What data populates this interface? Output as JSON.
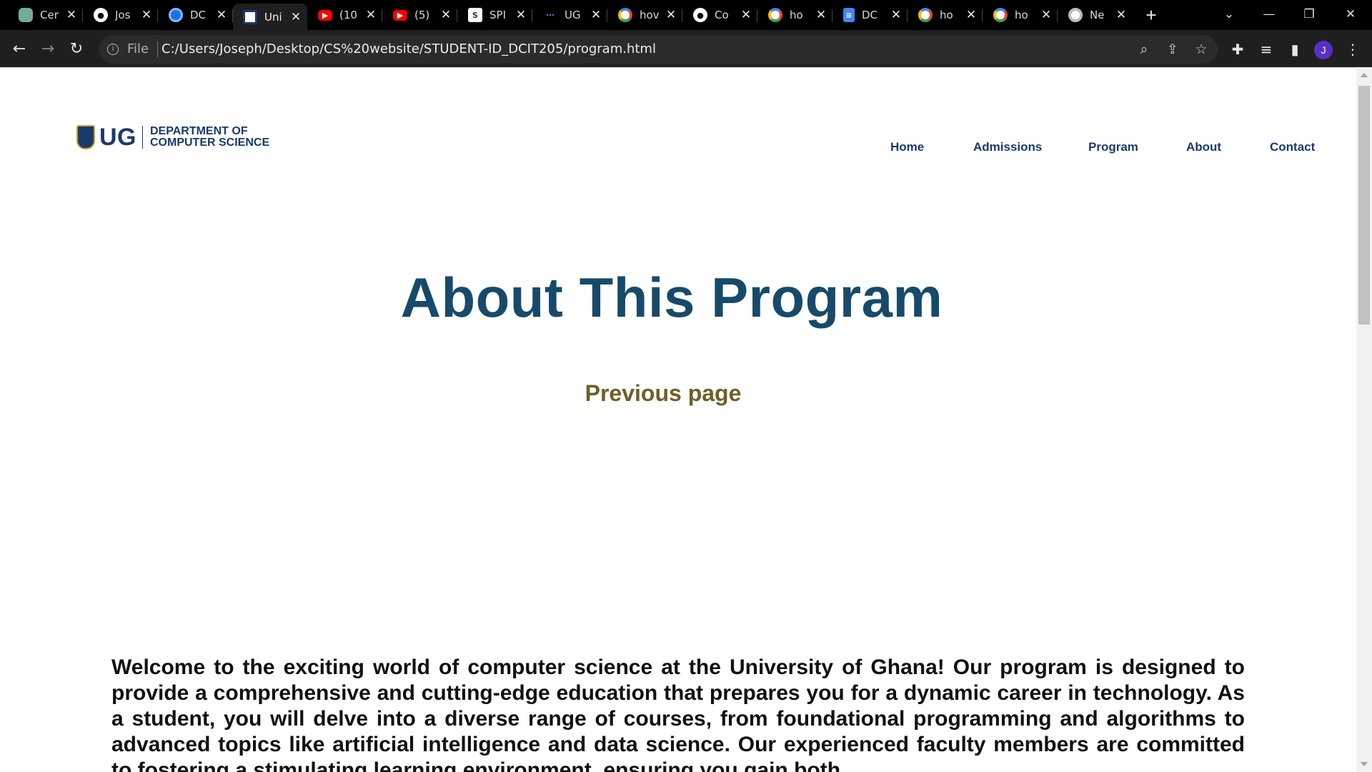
{
  "browser": {
    "tabs": [
      {
        "title": "Cer",
        "favicon": "chatgpt-icon",
        "active": false
      },
      {
        "title": "Jos",
        "favicon": "github-icon",
        "active": false
      },
      {
        "title": "DC",
        "favicon": "dc-icon",
        "active": false
      },
      {
        "title": "Uni",
        "favicon": "ug-crest-icon",
        "active": true
      },
      {
        "title": "(10",
        "favicon": "youtube-icon",
        "active": false
      },
      {
        "title": "(5)",
        "favicon": "youtube-icon",
        "active": false
      },
      {
        "title": "SPI",
        "favicon": "spl-icon",
        "active": false
      },
      {
        "title": "UG",
        "favicon": "ug-dots-icon",
        "active": false
      },
      {
        "title": "hov",
        "favicon": "google-icon",
        "active": false
      },
      {
        "title": "Co",
        "favicon": "github-icon",
        "active": false
      },
      {
        "title": "ho",
        "favicon": "google-icon",
        "active": false
      },
      {
        "title": "DC",
        "favicon": "google-docs-icon",
        "active": false
      },
      {
        "title": "ho",
        "favicon": "google-icon",
        "active": false
      },
      {
        "title": "ho",
        "favicon": "google-icon",
        "active": false
      },
      {
        "title": "Ne",
        "favicon": "chrome-icon",
        "active": false
      }
    ],
    "omnibox": {
      "scheme_label": "File",
      "url": "C:/Users/Joseph/Desktop/CS%20website/STUDENT-ID_DCIT205/program.html"
    },
    "profile_initial": "J"
  },
  "page": {
    "logo": {
      "abbrev": "UG",
      "department": "DEPARTMENT OF\nCOMPUTER SCIENCE"
    },
    "nav": [
      {
        "label": "Home"
      },
      {
        "label": "Admissions"
      },
      {
        "label": "Program"
      },
      {
        "label": "About"
      },
      {
        "label": "Contact"
      }
    ],
    "headline": "About This Program",
    "previous_link": "Previous page",
    "intro": "Welcome to the exciting world of computer science at the University of Ghana! Our program is designed to provide a comprehensive and cutting-edge education that prepares you for a dynamic career in technology. As a student, you will delve into a diverse range of courses, from foundational programming and algorithms to advanced topics like artificial intelligence and data science. Our experienced faculty members are committed to fostering a stimulating learning environment, ensuring you gain both"
  },
  "colors": {
    "brand_navy": "#1b3a6b",
    "headline": "#174a6a",
    "link_olive": "#6e5f27",
    "tabstrip_bg": "#000000",
    "toolbar_bg": "#1f1f1f"
  }
}
